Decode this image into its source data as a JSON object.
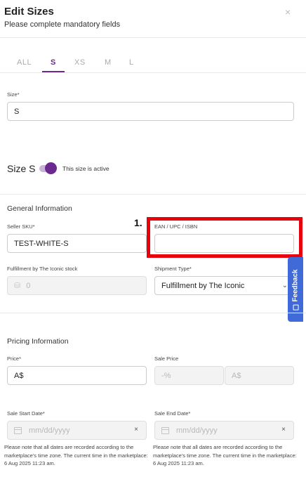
{
  "dialog": {
    "title": "Edit Sizes",
    "subtitle": "Please complete mandatory fields",
    "close_label": "×"
  },
  "tabs": [
    {
      "label": "ALL",
      "active": false
    },
    {
      "label": "S",
      "active": true
    },
    {
      "label": "XS",
      "active": false
    },
    {
      "label": "M",
      "active": false
    },
    {
      "label": "L",
      "active": false
    }
  ],
  "size_field": {
    "label": "Size*",
    "value": "S"
  },
  "size_status": {
    "heading": "Size S",
    "toggle_on": true,
    "toggle_text": "This size is active"
  },
  "general": {
    "title": "General Information",
    "seller_sku": {
      "label": "Seller SKU*",
      "value": "TEST-WHITE-S"
    },
    "ean": {
      "label": "EAN / UPC / ISBN",
      "value": ""
    },
    "stock": {
      "label": "Fulfillment by The Iconic stock",
      "value": "0",
      "icon": "stack-icon"
    },
    "shipment": {
      "label": "Shipment Type*",
      "value": "Fulfillment by The Iconic",
      "caret": "⌄"
    }
  },
  "annotation": {
    "number": "1.",
    "color": "#e8000b"
  },
  "feedback": {
    "label": "Feedback",
    "color": "#3f6ad8"
  },
  "pricing": {
    "title": "Pricing Information",
    "price": {
      "label": "Price*",
      "value": "A$"
    },
    "sale_price": {
      "label": "Sale Price",
      "percent_placeholder": "-%",
      "currency_placeholder": "A$"
    },
    "start_date": {
      "label": "Sale Start Date*",
      "placeholder": "mm/dd/yyyy",
      "clear": "×"
    },
    "end_date": {
      "label": "Sale End Date*",
      "placeholder": "mm/dd/yyyy",
      "clear": "×"
    },
    "note_left": "Please note that all dates are recorded according to the marketplace's time zone. The current time in the marketplace: 6 Aug 2025 11:23 am.",
    "note_right": "Please note that all dates are recorded according to the marketplace's time zone. The current time in the marketplace: 6 Aug 2025 11:23 am."
  },
  "colors": {
    "accent": "#6b2a8f",
    "annotation": "#e8000b"
  }
}
